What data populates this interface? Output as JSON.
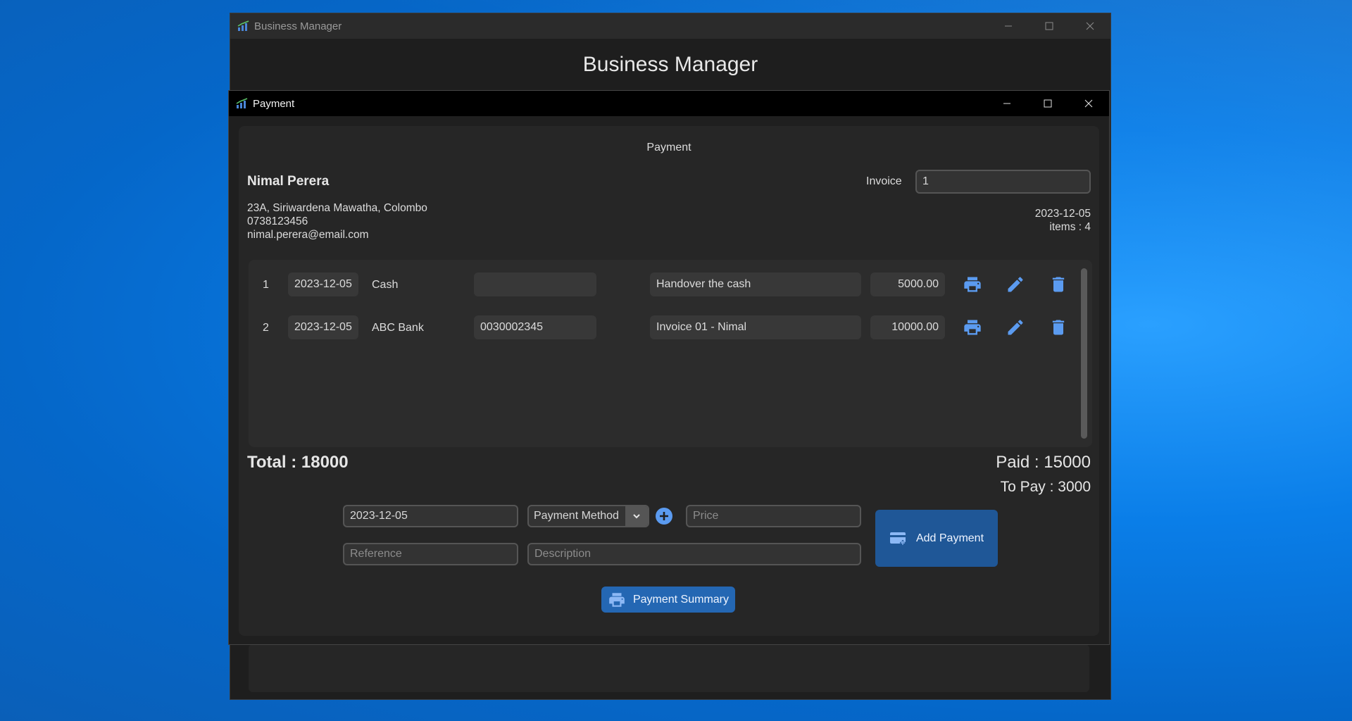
{
  "back_window": {
    "title": "Business Manager",
    "heading": "Business Manager"
  },
  "dialog": {
    "title": "Payment",
    "header_title": "Payment",
    "customer": {
      "name": "Nimal Perera",
      "address": "23A, Siriwardena Mawatha, Colombo",
      "phone": "0738123456",
      "email": "nimal.perera@email.com"
    },
    "invoice_label": "Invoice",
    "invoice_value": "1",
    "date": "2023-12-05",
    "items_text": "items : 4",
    "payments": [
      {
        "index": "1",
        "date": "2023-12-05",
        "method": "Cash",
        "reference": "",
        "description": "Handover the cash",
        "amount": "5000.00"
      },
      {
        "index": "2",
        "date": "2023-12-05",
        "method": "ABC Bank",
        "reference": "0030002345",
        "description": "Invoice 01 - Nimal",
        "amount": "10000.00"
      }
    ],
    "total_text": "Total : 18000",
    "paid_text": "Paid : 15000",
    "to_pay_text": "To Pay : 3000",
    "form": {
      "date_value": "2023-12-05",
      "method_value": "Payment Method",
      "price_placeholder": "Price",
      "reference_placeholder": "Reference",
      "description_placeholder": "Description",
      "add_button_label": "Add Payment"
    },
    "summary_button_label": "Payment Summary"
  },
  "colors": {
    "accent_icon": "#5b9bf0",
    "button_blue": "#1f5797",
    "desktop_blue": "#0a7ee8"
  }
}
